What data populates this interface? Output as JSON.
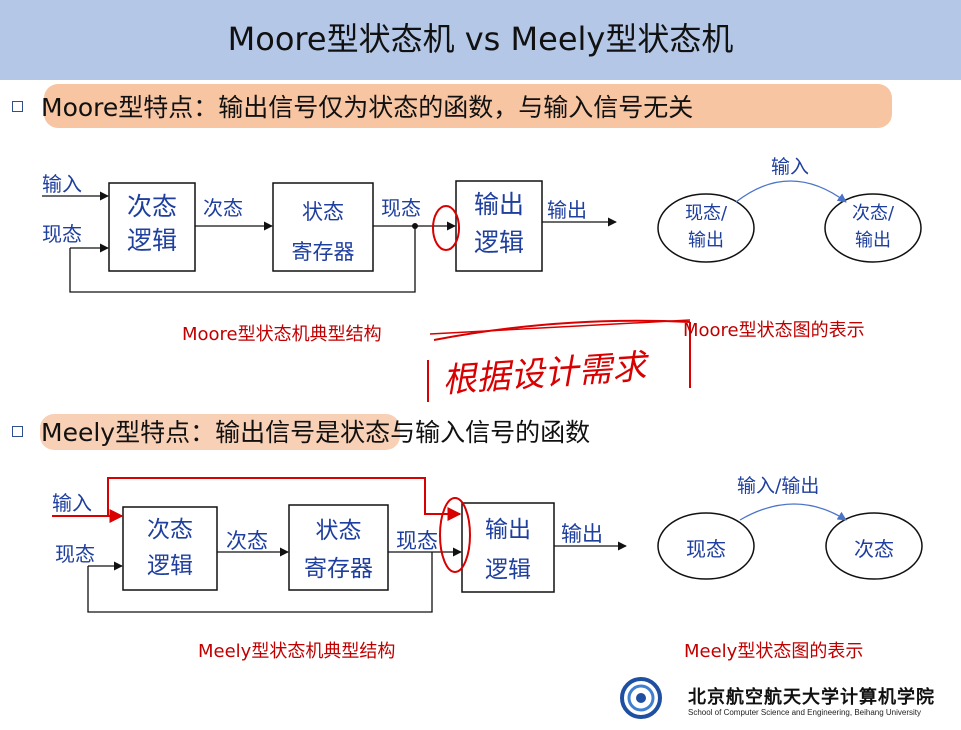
{
  "title": "Moore型状态机 vs Meely型状态机",
  "moore": {
    "bullet": "Moore型特点：输出信号仅为状态的函数，与输入信号无关",
    "label_input": "输入",
    "label_state": "现态",
    "block_next_line1": "次态",
    "block_next_line2": "逻辑",
    "wire_next": "次态",
    "block_reg_line1": "状态",
    "block_reg_line2": "寄存器",
    "wire_current": "现态",
    "block_out_line1": "输出",
    "block_out_line2": "逻辑",
    "wire_output": "输出",
    "caption_structure": "Moore型状态机典型结构",
    "diagram_edge_label": "输入",
    "node_current_line1": "现态/",
    "node_current_line2": "输出",
    "node_next_line1": "次态/",
    "node_next_line2": "输出",
    "caption_diagram": "Moore型状态图的表示"
  },
  "handwritten_note": "根据设计需求",
  "meely": {
    "bullet": "Meely型特点：输出信号是状态与输入信号的函数",
    "label_input": "输入",
    "label_state": "现态",
    "block_next_line1": "次态",
    "block_next_line2": "逻辑",
    "wire_next": "次态",
    "block_reg_line1": "状态",
    "block_reg_line2": "寄存器",
    "wire_current": "现态",
    "block_out_line1": "输出",
    "block_out_line2": "逻辑",
    "wire_output": "输出",
    "caption_structure": "Meely型状态机典型结构",
    "diagram_edge_label": "输入/输出",
    "node_current": "现态",
    "node_next": "次态",
    "caption_diagram": "Meely型状态图的表示"
  },
  "footer": {
    "school_cn": "北京航空航天大学计算机学院",
    "school_en": "School of Computer Science and Engineering, Beihang University"
  },
  "colors": {
    "title_bar": "#b4c7e7",
    "diagram_text": "#1f3f9f",
    "caption": "#c00000",
    "highlight": "#f4b183",
    "annotation": "#d80000"
  }
}
